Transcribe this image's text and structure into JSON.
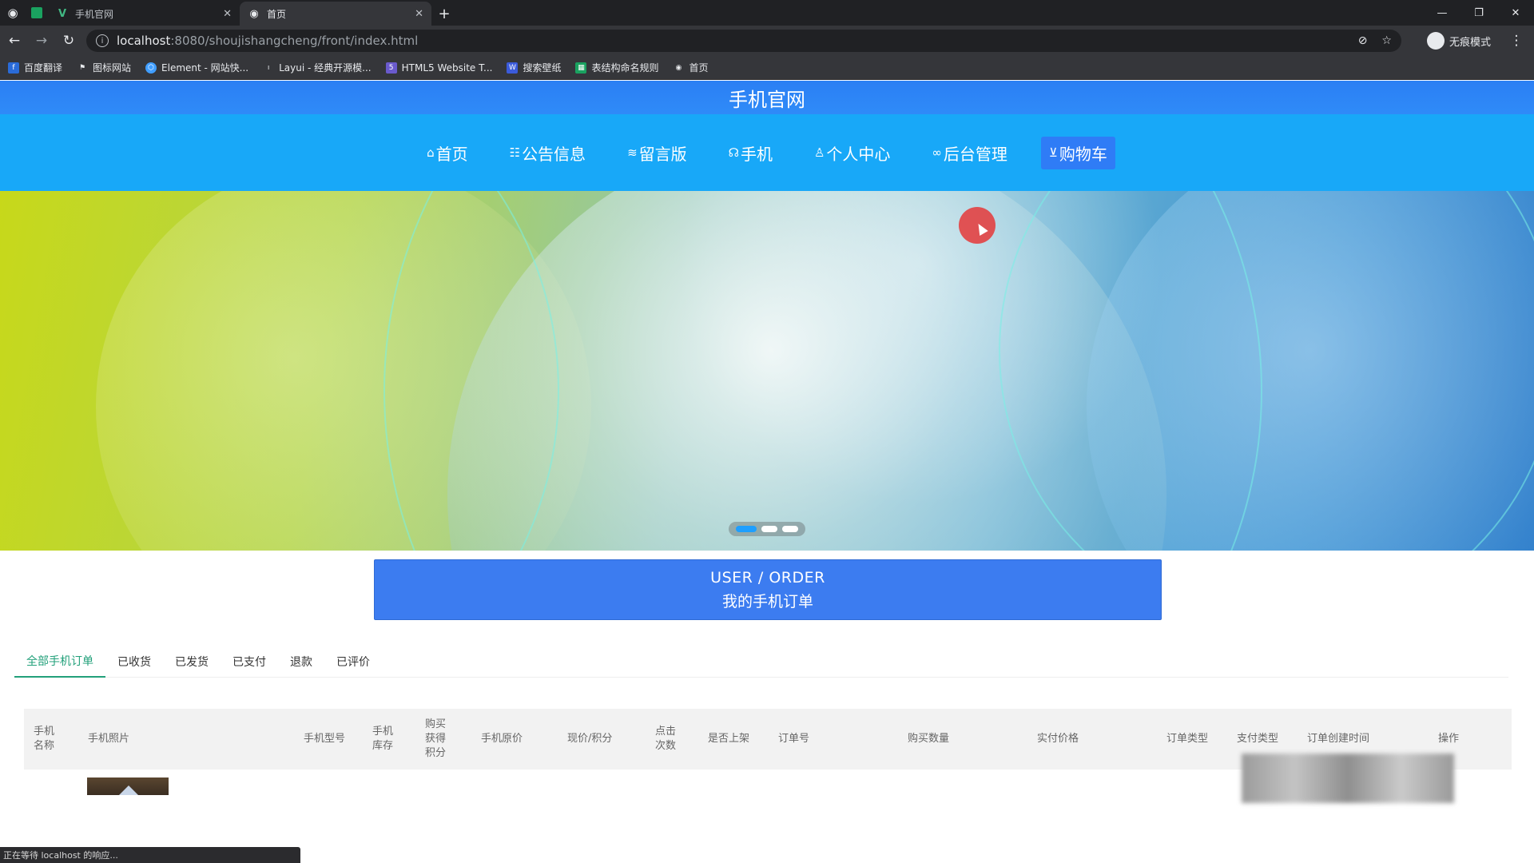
{
  "browser": {
    "tabs": [
      {
        "title": "手机官网",
        "active": false
      },
      {
        "title": "首页",
        "active": true
      }
    ],
    "url_host": "localhost",
    "url_path": ":8080/shoujishangcheng/front/index.html",
    "incognito_label": "无痕模式",
    "bookmarks": [
      "百度翻译",
      "图标网站",
      "Element - 网站快...",
      "Layui - 经典开源模...",
      "HTML5 Website T...",
      "搜索壁纸",
      "表结构命名规则",
      "首页"
    ],
    "status_text": "正在等待 localhost 的响应..."
  },
  "site": {
    "title": "手机官网",
    "nav": [
      {
        "label": "首页",
        "icon": "home-icon",
        "glyph": "⌂"
      },
      {
        "label": "公告信息",
        "icon": "notice-icon",
        "glyph": "☷"
      },
      {
        "label": "留言版",
        "icon": "message-icon",
        "glyph": "≋"
      },
      {
        "label": "手机",
        "icon": "phone-icon",
        "glyph": "☊"
      },
      {
        "label": "个人中心",
        "icon": "user-icon",
        "glyph": "♙"
      },
      {
        "label": "后台管理",
        "icon": "link-icon",
        "glyph": "∞"
      },
      {
        "label": "购物车",
        "icon": "cart-icon",
        "glyph": "⊻",
        "active": true
      }
    ]
  },
  "carousel": {
    "slides": 3,
    "active_index": 0
  },
  "order_section": {
    "title_en": "USER / ORDER",
    "title_cn": "我的手机订单"
  },
  "order_tabs": [
    {
      "label": "全部手机订单",
      "active": true
    },
    {
      "label": "已收货"
    },
    {
      "label": "已发货"
    },
    {
      "label": "已支付"
    },
    {
      "label": "退款"
    },
    {
      "label": "已评价"
    }
  ],
  "table": {
    "columns": [
      "手机名称",
      "手机照片",
      "手机型号",
      "手机库存",
      "购买获得积分",
      "手机原价",
      "现价/积分",
      "点击次数",
      "是否上架",
      "订单号",
      "购买数量",
      "实付价格",
      "订单类型",
      "支付类型",
      "订单创建时间",
      "操作"
    ]
  },
  "colors": {
    "header_blue": "#2f8bf8",
    "nav_blue": "#18a8f8",
    "order_banner": "#3c7cf0",
    "tab_active": "#22a07a"
  }
}
